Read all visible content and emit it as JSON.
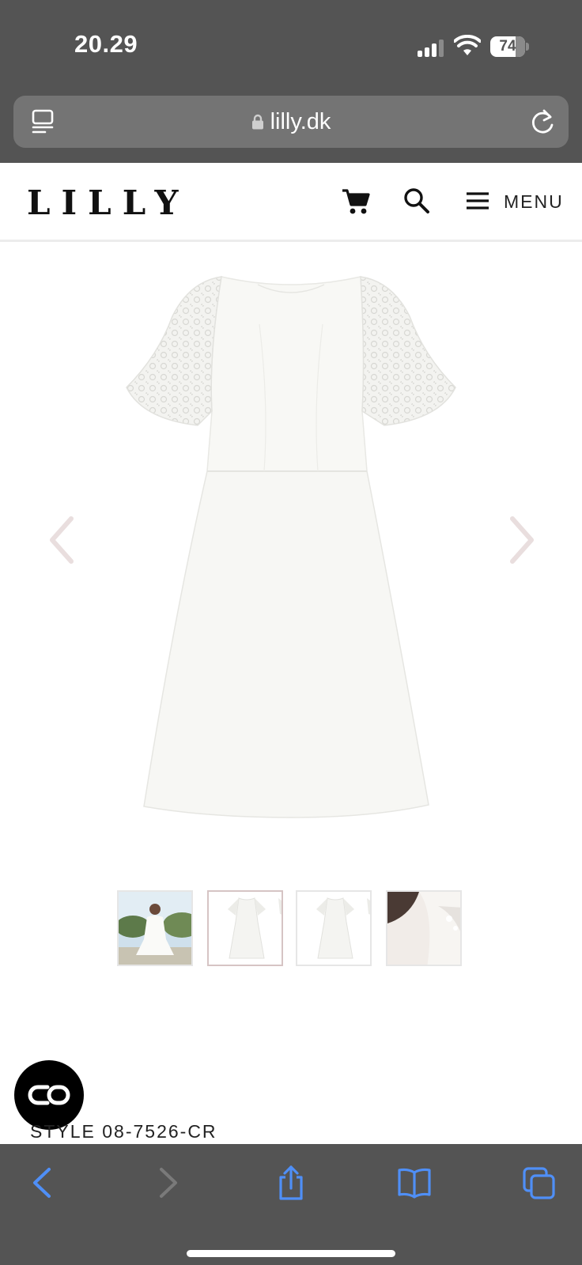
{
  "status_bar": {
    "time": "20.29",
    "battery_level": "74"
  },
  "browser": {
    "url": "lilly.dk"
  },
  "header": {
    "logo": "LILLY",
    "menu_label": "MENU"
  },
  "product": {
    "style_code": "STYLE 08-7526-CR",
    "thumbnail_count": 4,
    "active_thumbnail": 2
  },
  "colors": {
    "chrome": "#545454",
    "url_bar": "#747474",
    "toolbar_icon": "#4f8ff7",
    "arrow": "#e9dede"
  }
}
